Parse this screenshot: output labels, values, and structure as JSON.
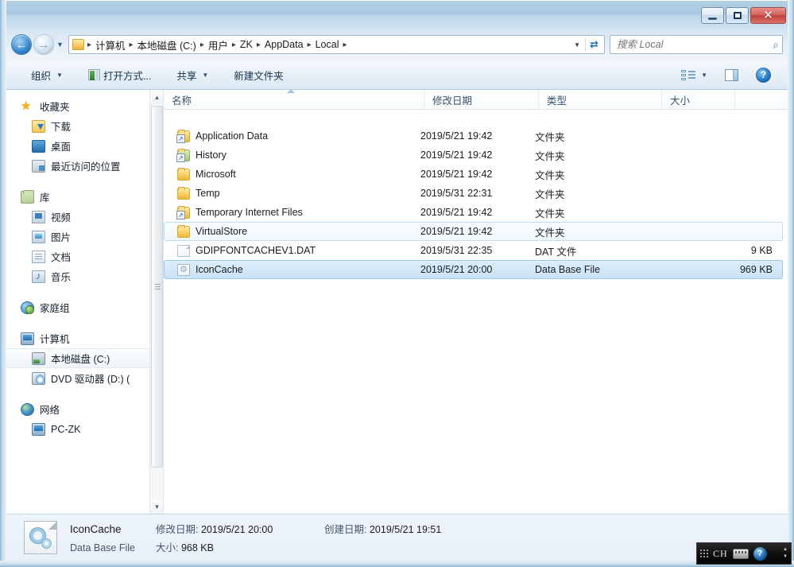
{
  "window": {
    "minimize_label": "最小化",
    "maximize_label": "最大化",
    "close_label": "关闭"
  },
  "address_bar": {
    "back_label": "←",
    "forward_label": "→",
    "history_dropdown": "▼",
    "crumbs": [
      "计算机",
      "本地磁盘 (C:)",
      "用户",
      "ZK",
      "AppData",
      "Local"
    ],
    "separator": "▸",
    "refresh_label": "⟳",
    "folder_icon": "folder-icon"
  },
  "search": {
    "placeholder": "搜索 Local",
    "value": "",
    "icon": "search-icon"
  },
  "toolbar": {
    "organize_label": "组织",
    "open_with_label": "打开方式...",
    "share_label": "共享",
    "new_folder_label": "新建文件夹",
    "caret": "▼",
    "views_icon": "views-icon",
    "preview_pane_icon": "preview-pane-icon",
    "help_icon": "help-icon",
    "help_glyph": "?"
  },
  "sidebar": {
    "groups": [
      {
        "header": {
          "label": "收藏夹",
          "icon": "star-icon"
        },
        "items": [
          {
            "label": "下载",
            "icon": "downloads-folder-icon"
          },
          {
            "label": "桌面",
            "icon": "desktop-icon"
          },
          {
            "label": "最近访问的位置",
            "icon": "recent-places-icon"
          }
        ]
      },
      {
        "header": {
          "label": "库",
          "icon": "library-icon"
        },
        "items": [
          {
            "label": "视频",
            "icon": "video-library-icon"
          },
          {
            "label": "图片",
            "icon": "pictures-library-icon"
          },
          {
            "label": "文档",
            "icon": "documents-library-icon"
          },
          {
            "label": "音乐",
            "icon": "music-library-icon"
          }
        ]
      },
      {
        "header": {
          "label": "家庭组",
          "icon": "homegroup-icon"
        },
        "items": []
      },
      {
        "header": {
          "label": "计算机",
          "icon": "computer-icon"
        },
        "items": [
          {
            "label": "本地磁盘 (C:)",
            "icon": "hard-drive-icon",
            "selected": true
          },
          {
            "label": "DVD 驱动器 (D:) (",
            "icon": "dvd-drive-icon"
          }
        ]
      },
      {
        "header": {
          "label": "网络",
          "icon": "network-icon"
        },
        "items": [
          {
            "label": "PC-ZK",
            "icon": "computer-node-icon"
          }
        ]
      }
    ],
    "scroll_up": "▲",
    "scroll_down": "▼"
  },
  "file_list": {
    "columns": [
      {
        "key": "name",
        "label": "名称",
        "sorted": true,
        "sort_dir": "asc"
      },
      {
        "key": "date",
        "label": "修改日期"
      },
      {
        "key": "type",
        "label": "类型"
      },
      {
        "key": "size",
        "label": "大小"
      }
    ],
    "rows": [
      {
        "name": "Application Data",
        "date": "2019/5/21 19:42",
        "type": "文件夹",
        "size": "",
        "icon": "folder-junction-icon",
        "state": ""
      },
      {
        "name": "History",
        "date": "2019/5/21 19:42",
        "type": "文件夹",
        "size": "",
        "icon": "folder-history-junction-icon",
        "state": ""
      },
      {
        "name": "Microsoft",
        "date": "2019/5/21 19:42",
        "type": "文件夹",
        "size": "",
        "icon": "folder-icon",
        "state": ""
      },
      {
        "name": "Temp",
        "date": "2019/5/31 22:31",
        "type": "文件夹",
        "size": "",
        "icon": "folder-icon",
        "state": ""
      },
      {
        "name": "Temporary Internet Files",
        "date": "2019/5/21 19:42",
        "type": "文件夹",
        "size": "",
        "icon": "folder-junction-icon",
        "state": ""
      },
      {
        "name": "VirtualStore",
        "date": "2019/5/21 19:42",
        "type": "文件夹",
        "size": "",
        "icon": "folder-icon",
        "state": "hover"
      },
      {
        "name": "GDIPFONTCACHEV1.DAT",
        "date": "2019/5/31 22:35",
        "type": "DAT 文件",
        "size": "9 KB",
        "icon": "generic-file-icon",
        "state": ""
      },
      {
        "name": "IconCache",
        "date": "2019/5/21 20:00",
        "type": "Data Base File",
        "size": "969 KB",
        "icon": "database-file-icon",
        "state": "selected"
      }
    ]
  },
  "details_pane": {
    "icon": "database-file-icon",
    "name": "IconCache",
    "type": "Data Base File",
    "modified_label": "修改日期:",
    "modified_value": "2019/5/21 20:00",
    "created_label": "创建日期:",
    "created_value": "2019/5/21 19:51",
    "size_label": "大小:",
    "size_value": "968 KB"
  },
  "ime_bar": {
    "language": "CH",
    "keyboard_icon": "keyboard-icon",
    "help_icon": "help-icon",
    "help_glyph": "?",
    "grip_icon": "drag-grip-icon"
  },
  "colors": {
    "frame_glass": "#a9c8e0",
    "selection": "#c9e3f8",
    "hover": "#eef7fd",
    "accent": "#1d6fb8",
    "close_button": "#c0413a"
  }
}
